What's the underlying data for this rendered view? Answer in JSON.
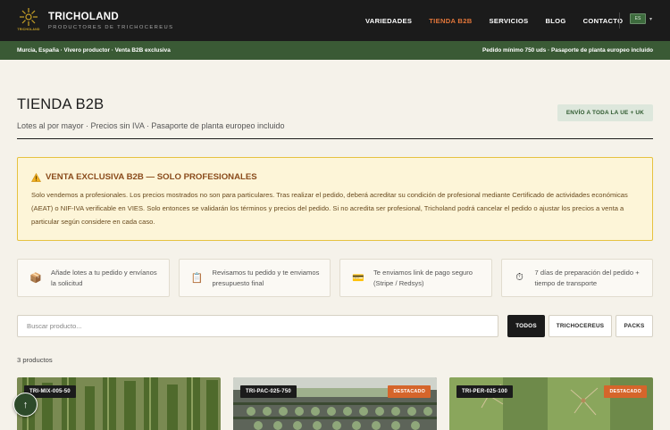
{
  "brand": {
    "name": "TRICHOLAND",
    "tagline": "PRODUCTORES DE TRICHOCEREUS",
    "logo_mini": "TRICHOLAND"
  },
  "nav": {
    "items": [
      {
        "label": "VARIEDADES"
      },
      {
        "label": "TIENDA B2B"
      },
      {
        "label": "SERVICIOS"
      },
      {
        "label": "BLOG"
      },
      {
        "label": "CONTACTO"
      }
    ],
    "active": "TIENDA B2B",
    "lang_flag": "ES",
    "lang_caret": "▾"
  },
  "info_bar": {
    "left": "Murcia, España · Vivero productor · Venta B2B exclusiva",
    "right": "Pedido mínimo 750 uds · Pasaporte de planta europeo incluido"
  },
  "page": {
    "title": "TIENDA B2B",
    "subtitle": "Lotes al por mayor · Precios sin IVA · Pasaporte de planta europeo incluido",
    "shipping_badge": "ENVÍO A TODA LA UE + UK"
  },
  "warning": {
    "title": "VENTA EXCLUSIVA B2B — SOLO PROFESIONALES",
    "body": "Solo vendemos a profesionales. Los precios mostrados no son para particulares. Tras realizar el pedido, deberá acreditar su condición de profesional mediante Certificado de actividades económicas (AEAT) o NIF-IVA verificable en VIES. Solo entonces se validarán los términos y precios del pedido. Si no acredita ser profesional, Tricholand podrá cancelar el pedido o ajustar los precios a venta a particular según considere en cada caso."
  },
  "steps": [
    {
      "icon": "📦",
      "icon_name": "package-icon",
      "text": "Añade lotes a tu pedido y envíanos la solicitud"
    },
    {
      "icon": "📋",
      "icon_name": "clipboard-icon",
      "text": "Revisamos tu pedido y te enviamos presupuesto final"
    },
    {
      "icon": "💳",
      "icon_name": "card-icon",
      "text": "Te enviamos link de pago seguro (Stripe / Redsys)"
    },
    {
      "icon": "⏱",
      "icon_name": "stopwatch-icon",
      "text": "7 días de preparación del pedido + tiempo de transporte"
    }
  ],
  "search": {
    "placeholder": "Buscar producto..."
  },
  "filters": [
    {
      "label": "TODOS"
    },
    {
      "label": "TRICHOCEREUS"
    },
    {
      "label": "PACKS"
    }
  ],
  "filter_active": "TODOS",
  "results_count": "3 productos",
  "products": [
    {
      "sku": "TRI-MIX-005-50",
      "badge": ""
    },
    {
      "sku": "TRI-PAC-025-750",
      "badge": "DESTACADO"
    },
    {
      "sku": "TRI-PER-025-100",
      "badge": "DESTACADO"
    }
  ],
  "scroll_top_icon": "↑",
  "colors": {
    "header_bg": "#1b1b1b",
    "accent_orange": "#e3763a",
    "info_bar_green": "#3a5a35",
    "page_bg": "#f5f2ea",
    "warning_bg": "#fdf5d8",
    "warning_border": "#e6c240",
    "badge_orange": "#d5652b"
  }
}
